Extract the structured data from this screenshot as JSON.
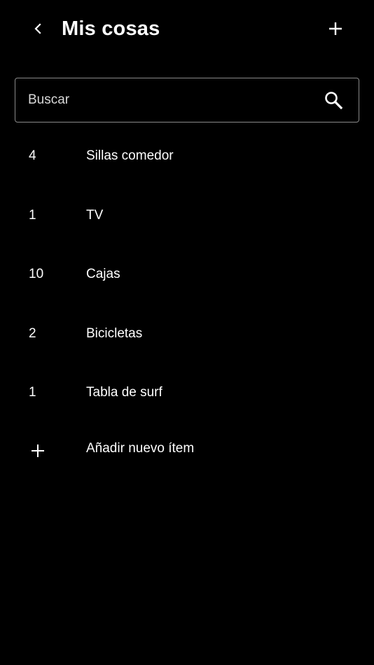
{
  "header": {
    "title": "Mis cosas",
    "back_icon": "chevron-left-icon",
    "add_icon": "plus-icon"
  },
  "search": {
    "placeholder": "Buscar",
    "value": "",
    "icon": "search-icon"
  },
  "items": [
    {
      "quantity": "4",
      "name": "Sillas comedor"
    },
    {
      "quantity": "1",
      "name": "TV"
    },
    {
      "quantity": "10",
      "name": "Cajas"
    },
    {
      "quantity": "2",
      "name": "Bicicletas"
    },
    {
      "quantity": "1",
      "name": "Tabla de surf"
    }
  ],
  "add_item": {
    "label": "Añadir nuevo ítem",
    "icon": "plus-icon"
  },
  "colors": {
    "background": "#000000",
    "text": "#ffffff",
    "search_border": "#8a8a8a"
  }
}
